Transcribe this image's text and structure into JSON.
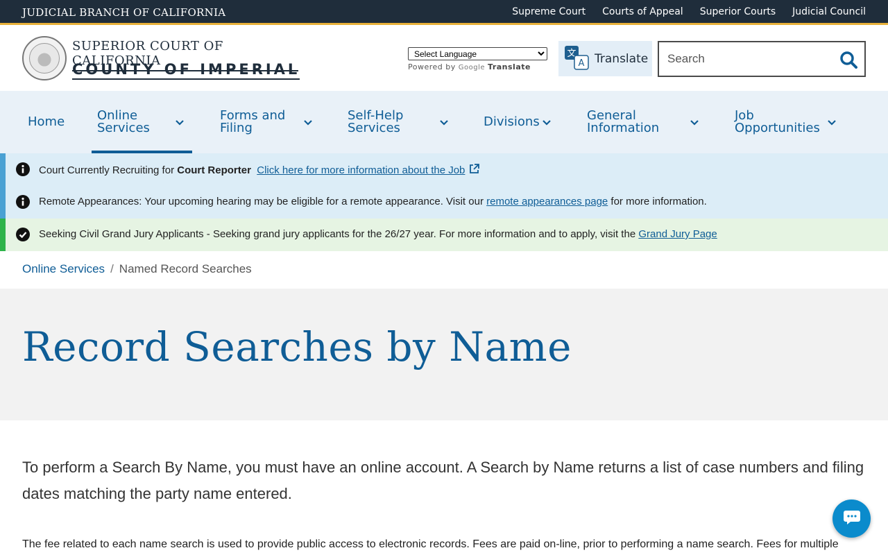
{
  "topbar": {
    "branch": "JUDICIAL BRANCH OF CALIFORNIA",
    "links": [
      "Supreme Court",
      "Courts of Appeal",
      "Superior Courts",
      "Judicial Council"
    ]
  },
  "header": {
    "court_line1": "SUPERIOR COURT OF CALIFORNIA",
    "court_line2": "COUNTY OF IMPERIAL",
    "language_select": "Select Language",
    "powered_by": "Powered by",
    "google": "Google",
    "translate_word": "Translate",
    "translate_button": "Translate",
    "search_placeholder": "Search"
  },
  "nav": {
    "items": [
      {
        "label": "Home"
      },
      {
        "label": "Online Services"
      },
      {
        "label": "Forms and Filing"
      },
      {
        "label": "Self-Help Services"
      },
      {
        "label": "Divisions"
      },
      {
        "label": "General Information"
      },
      {
        "label": "Job Opportunities"
      }
    ]
  },
  "alerts": [
    {
      "type": "info",
      "prefix": "Court Currently Recruiting for ",
      "bold": "Court Reporter",
      "link": "Click here for more information about the Job"
    },
    {
      "type": "info",
      "prefix": "Remote Appearances: Your upcoming hearing may be eligible for a remote appearance. Visit our ",
      "link": "remote appearances page",
      "suffix": " for more information."
    },
    {
      "type": "success",
      "prefix": "Seeking Civil Grand Jury Applicants - Seeking grand jury applicants for the 26/27 year. For more information and to apply, visit the ",
      "link": "Grand Jury Page"
    }
  ],
  "breadcrumb": {
    "parent": "Online Services",
    "separator": "/",
    "current": "Named Record Searches"
  },
  "page": {
    "title": "Record Searches by Name",
    "lead": "To perform a Search By Name, you must have an online account. A Search by Name returns a list of case numbers and filing dates matching the party name entered.",
    "para": "The fee related to each name search is used to provide public access to electronic records. Fees are paid on-line, prior to performing a name search. Fees for multiple"
  },
  "colors": {
    "primary": "#0f5d96",
    "topbar": "#1f2d3b",
    "accent_gold": "#e8b13a",
    "nav_bg": "#e9f1f8",
    "info_bg": "#dcedf7",
    "success_bg": "#e6f4e3",
    "chat": "#0b8bcc"
  },
  "icons": {
    "search": "search-icon",
    "chevron": "chevron-down-icon",
    "info": "info-circle-icon",
    "check": "check-circle-icon",
    "external": "external-link-icon",
    "translate": "translate-icon",
    "chat": "chat-bubble-icon"
  }
}
